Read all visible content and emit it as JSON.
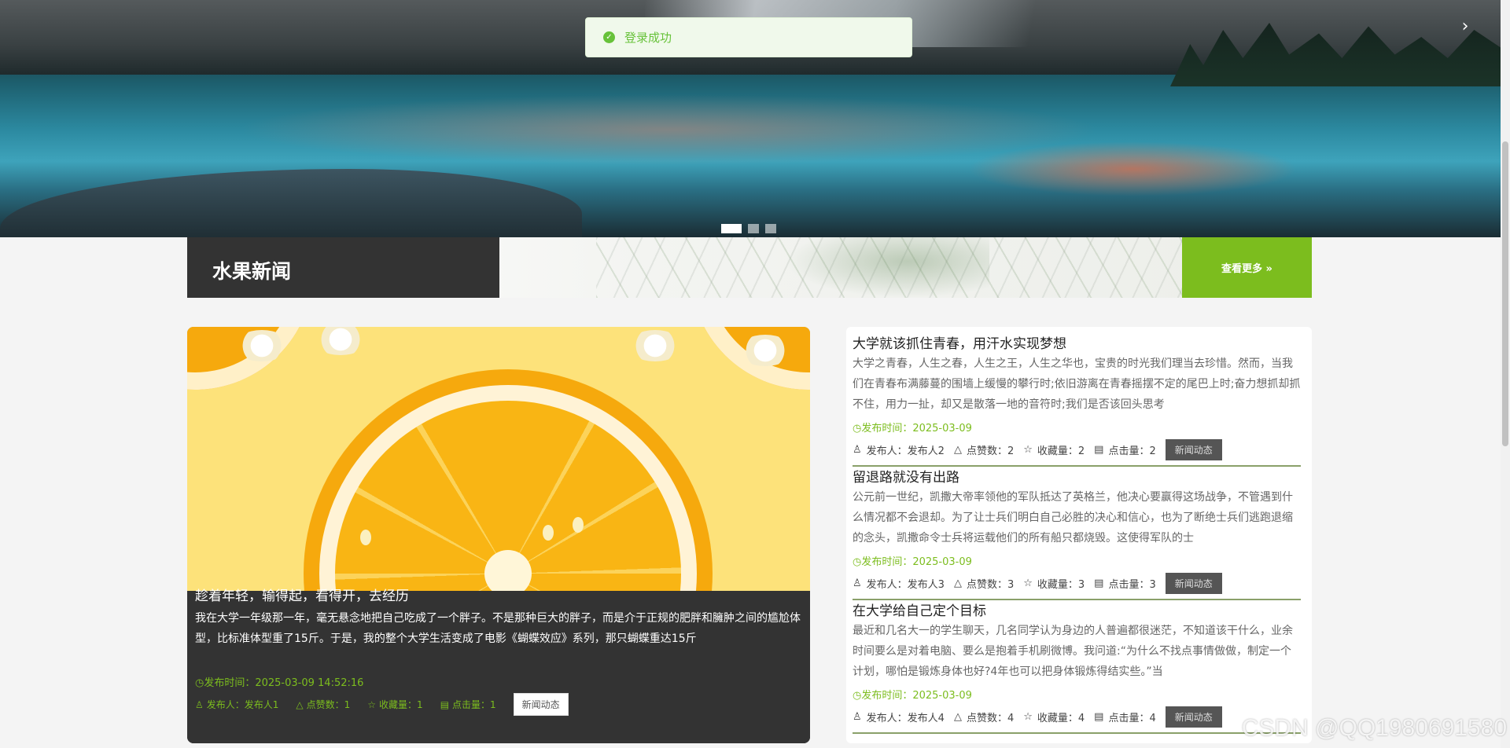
{
  "toast": {
    "message": "登录成功",
    "icon": "check-circle-icon",
    "color": "#67c23a"
  },
  "banner": {
    "next_icon": "›",
    "slides": 3,
    "active_slide": 1
  },
  "section": {
    "title": "水果新闻",
    "more_label": "查看更多 »",
    "accent": "#7cbd1e"
  },
  "featured": {
    "title": "趁着年轻，输得起，看得开，去经历",
    "desc": "我在大学一年级那一年，毫无悬念地把自己吃成了一个胖子。不是那种巨大的胖子，而是介于正规的肥胖和臃肿之间的尴尬体型，比标准体型重了15斤。于是，我的整个大学生活变成了电影《蝴蝶效应》系列，那只蝴蝶重达15斤",
    "time": "发布时间：2025-03-09 14:52:16",
    "publisher": "发布人：发布人1",
    "likes": "点赞数：1",
    "favorites": "收藏量：1",
    "clicks": "点击量：1",
    "tag": "新闻动态"
  },
  "news": [
    {
      "title": "大学就该抓住青春，用汗水实现梦想",
      "desc": "大学之青春，人生之春，人生之王，人生之华也，宝贵的时光我们理当去珍惜。然而，当我们在青春布满藤蔓的围墙上缓慢的攀行时;依旧游离在青春摇摆不定的尾巴上时;奋力想抓却抓不住，用力一扯，却又是散落一地的音符时;我们是否该回头思考",
      "time": "发布时间：2025-03-09",
      "publisher": "发布人：发布人2",
      "likes": "点赞数：2",
      "favorites": "收藏量：2",
      "clicks": "点击量：2",
      "tag": "新闻动态"
    },
    {
      "title": "留退路就没有出路",
      "desc": "公元前一世纪，凯撒大帝率领他的军队抵达了英格兰，他决心要赢得这场战争，不管遇到什么情况都不会退却。为了让士兵们明白自己必胜的决心和信心，也为了断绝士兵们逃跑退缩的念头，凯撒命令士兵将运载他们的所有船只都烧毁。这使得军队的士",
      "time": "发布时间：2025-03-09",
      "publisher": "发布人：发布人3",
      "likes": "点赞数：3",
      "favorites": "收藏量：3",
      "clicks": "点击量：3",
      "tag": "新闻动态"
    },
    {
      "title": "在大学给自己定个目标",
      "desc": "最近和几名大一的学生聊天，几名同学认为身边的人普遍都很迷茫，不知道该干什么，业余时间要么是对着电脑、要么是抱着手机刷微博。我问道:“为什么不找点事情做做，制定一个计划，哪怕是锻炼身体也好?4年也可以把身体锻炼得结实些。”当",
      "time": "发布时间：2025-03-09",
      "publisher": "发布人：发布人4",
      "likes": "点赞数：4",
      "favorites": "收藏量：4",
      "clicks": "点击量：4",
      "tag": "新闻动态"
    }
  ],
  "watermark": "CSDN @QQ1980691580"
}
